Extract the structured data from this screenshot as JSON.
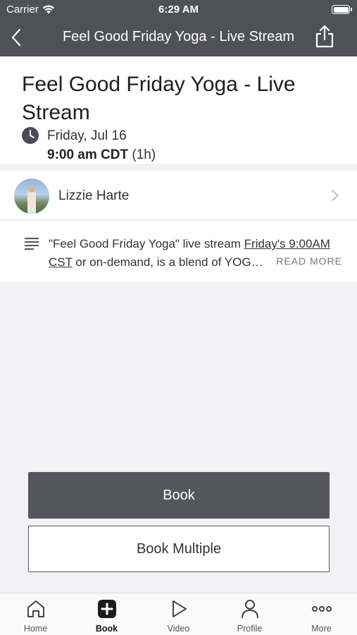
{
  "status_bar": {
    "carrier": "Carrier",
    "time": "6:29 AM"
  },
  "nav": {
    "title": "Feel Good Friday Yoga - Live Stream",
    "back_icon": "chevron-left-icon",
    "share_icon": "share-icon"
  },
  "event": {
    "title": "Feel Good Friday Yoga - Live Stream",
    "date": "Friday, Jul 16",
    "time": "9:00 am CDT",
    "duration": "(1h)"
  },
  "instructor": {
    "name": "Lizzie Harte"
  },
  "description": {
    "part1": "\"Feel Good Friday Yoga\" live stream ",
    "link": "Friday's 9:00AM CST",
    "part2": " or on-demand, is a blend of YOG…",
    "read_more": "READ MORE"
  },
  "actions": {
    "book": "Book",
    "book_multiple": "Book Multiple"
  },
  "tabs": [
    {
      "label": "Home",
      "icon": "home-icon"
    },
    {
      "label": "Book",
      "icon": "plus-square-icon",
      "active": true
    },
    {
      "label": "Video",
      "icon": "play-icon"
    },
    {
      "label": "Profile",
      "icon": "person-icon"
    },
    {
      "label": "More",
      "icon": "more-dots-icon"
    }
  ],
  "colors": {
    "header_bg": "#4f5157",
    "primary_button": "#54565c",
    "page_bg": "#f2f2f4"
  }
}
